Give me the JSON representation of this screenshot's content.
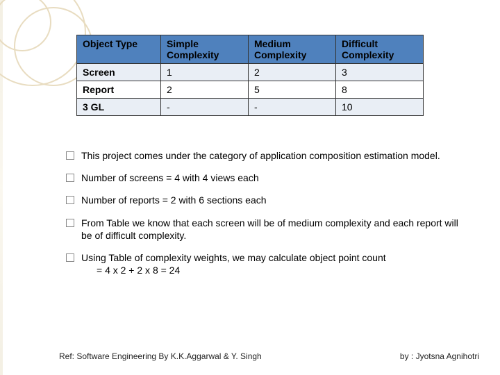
{
  "chart_data": {
    "type": "table",
    "title": "",
    "columns": [
      "Object Type",
      "Simple Complexity",
      "Medium Complexity",
      "Difficult Complexity"
    ],
    "rows": [
      {
        "object_type": "Screen",
        "simple": "1",
        "medium": "2",
        "difficult": "3"
      },
      {
        "object_type": "Report",
        "simple": "2",
        "medium": "5",
        "difficult": "8"
      },
      {
        "object_type": "3 GL",
        "simple": "-",
        "medium": "-",
        "difficult": "10"
      }
    ]
  },
  "table": {
    "headers": {
      "c0": "Object Type",
      "c1a": "Simple",
      "c1b": "Complexity",
      "c2a": "Medium",
      "c2b": "Complexity",
      "c3a": "Difficult",
      "c3b": "Complexity"
    },
    "r0": {
      "c0": "Screen",
      "c1": "1",
      "c2": "2",
      "c3": "3"
    },
    "r1": {
      "c0": "Report",
      "c1": "2",
      "c2": "5",
      "c3": "8"
    },
    "r2": {
      "c0": "3 GL",
      "c1": "-",
      "c2": "-",
      "c3": "10"
    }
  },
  "bullets": {
    "b0": "This project comes under the category of application composition estimation model.",
    "b1": "Number of screens = 4 with 4 views each",
    "b2": "Number of reports = 2 with 6 sections each",
    "b3": "From Table  we know that each screen will be of medium complexity and each report will be of difficult complexity.",
    "b4_line1": "Using Table  of complexity weights, we may calculate object point count",
    "b4_line2": "= 4 x 2 + 2 x 8 = 24"
  },
  "footer": {
    "left": "Ref: Software Engineering By K.K.Aggarwal & Y. Singh",
    "right": "by : Jyotsna Agnihotri"
  }
}
